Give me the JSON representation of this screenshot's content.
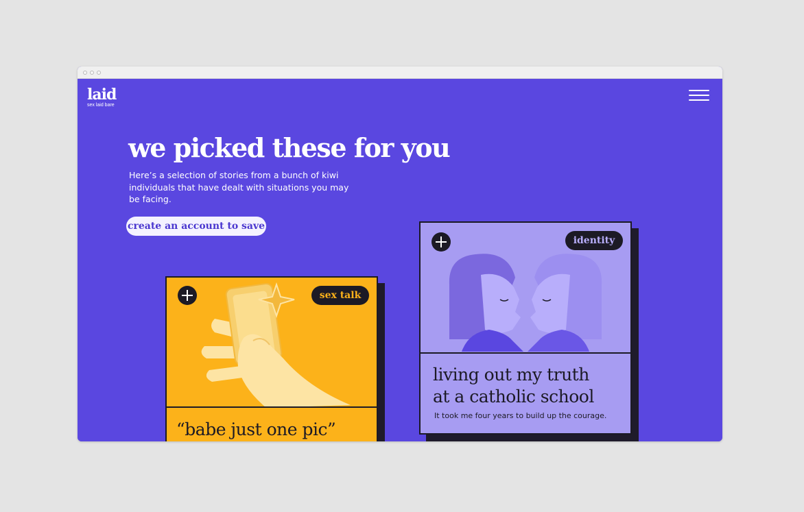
{
  "brand": {
    "name": "laid",
    "tagline": "sex laid bare"
  },
  "header": {
    "menu_icon": "hamburger-menu-icon"
  },
  "hero": {
    "title": "we picked these for you",
    "description": "Here’s a selection of stories from a bunch of kiwi individuals that have dealt with situations you may be facing.",
    "cta_label": "create an account to save"
  },
  "cards": [
    {
      "tag": "sex talk",
      "title": "“babe just one pic”",
      "subtitle": "",
      "illustration": "hand-holding-phone-illustration",
      "colors": {
        "background": "#fcb21a",
        "tag_text": "#fcb21a"
      }
    },
    {
      "tag": "identity",
      "title_line1": "living out my truth",
      "title_line2": "at a catholic school",
      "subtitle": "It took me four years to build up the courage.",
      "illustration": "two-people-kissing-illustration",
      "colors": {
        "background": "#a79cf2",
        "tag_text": "#b8aefb"
      }
    }
  ],
  "colors": {
    "page_background": "#5a47e0",
    "ink": "#1c1a25",
    "cta_text": "#4a37cf"
  }
}
